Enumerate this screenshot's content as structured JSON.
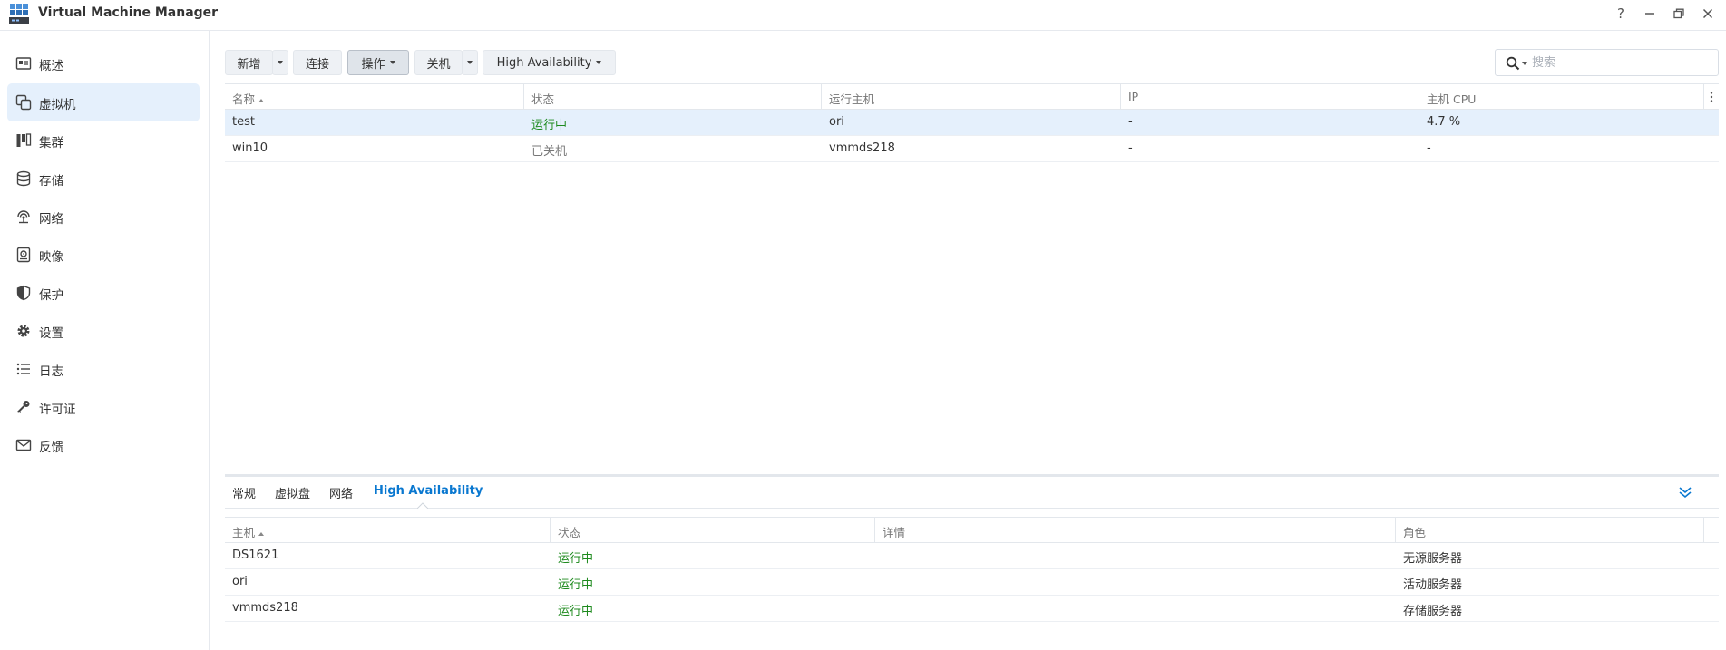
{
  "app": {
    "title": "Virtual Machine Manager"
  },
  "window_controls": {
    "help": "?"
  },
  "sidebar": {
    "items": [
      {
        "label": "概述",
        "icon": "overview-icon",
        "active": false
      },
      {
        "label": "虚拟机",
        "icon": "vm-icon",
        "active": true
      },
      {
        "label": "集群",
        "icon": "cluster-icon",
        "active": false
      },
      {
        "label": "存储",
        "icon": "storage-icon",
        "active": false
      },
      {
        "label": "网络",
        "icon": "network-icon",
        "active": false
      },
      {
        "label": "映像",
        "icon": "image-icon",
        "active": false
      },
      {
        "label": "保护",
        "icon": "shield-icon",
        "active": false
      },
      {
        "label": "设置",
        "icon": "gear-icon",
        "active": false
      },
      {
        "label": "日志",
        "icon": "log-icon",
        "active": false
      },
      {
        "label": "许可证",
        "icon": "key-icon",
        "active": false
      },
      {
        "label": "反馈",
        "icon": "mail-icon",
        "active": false
      }
    ]
  },
  "toolbar": {
    "create": "新增",
    "connect": "连接",
    "action": "操作",
    "shutdown": "关机",
    "high_availability": "High Availability"
  },
  "search": {
    "placeholder": "搜索"
  },
  "vm_table": {
    "columns": [
      "名称",
      "状态",
      "运行主机",
      "IP",
      "主机 CPU"
    ],
    "rows": [
      {
        "name": "test",
        "status": "运行中",
        "host": "ori",
        "ip": "-",
        "cpu": "4.7 %",
        "selected": true
      },
      {
        "name": "win10",
        "status": "已关机",
        "host": "vmmds218",
        "ip": "-",
        "cpu": "-",
        "selected": false
      }
    ]
  },
  "detail_tabs": {
    "tabs": [
      "常规",
      "虚拟盘",
      "网络",
      "High Availability"
    ],
    "active": "High Availability"
  },
  "ha_table": {
    "columns": [
      "主机",
      "状态",
      "详情",
      "角色"
    ],
    "rows": [
      {
        "host": "DS1621",
        "status": "运行中",
        "detail": "",
        "role": "无源服务器"
      },
      {
        "host": "ori",
        "status": "运行中",
        "detail": "",
        "role": "活动服务器"
      },
      {
        "host": "vmmds218",
        "status": "运行中",
        "detail": "",
        "role": "存储服务器"
      }
    ]
  },
  "colors": {
    "accent": "#0a78d0",
    "running": "#1e8a1e",
    "selected_bg": "#e5f0fc"
  }
}
